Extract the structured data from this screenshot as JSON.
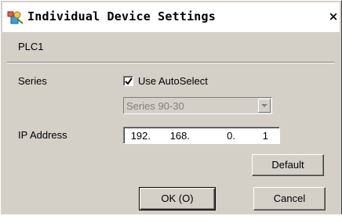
{
  "window": {
    "title": "Individual Device Settings",
    "title_icon": "device-settings-icon",
    "close_label": "×"
  },
  "device": {
    "name": "PLC1"
  },
  "series": {
    "label": "Series",
    "autoselect_label": "Use AutoSelect",
    "autoselect_checked": true,
    "value": "Series 90-30"
  },
  "ip": {
    "label": "IP Address",
    "octets": [
      "192.",
      "168.",
      "0.",
      "1"
    ]
  },
  "buttons": {
    "default_label": "Default",
    "ok_label": "OK (O)",
    "cancel_label": "Cancel"
  }
}
